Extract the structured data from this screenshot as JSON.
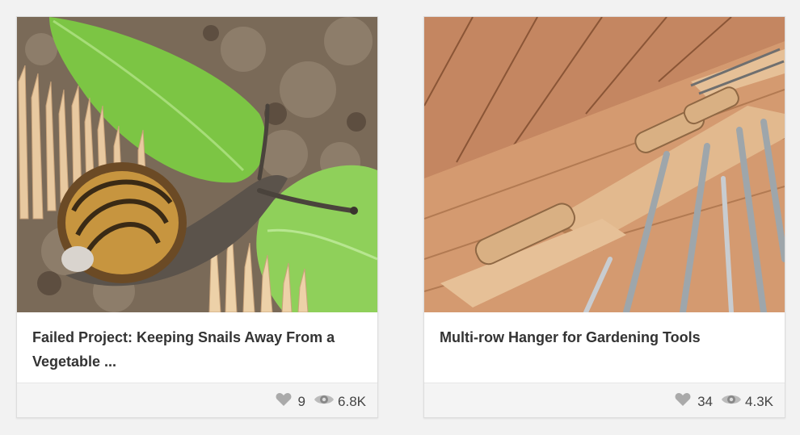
{
  "cards": [
    {
      "title": "Failed Project: Keeping Snails Away From a Vegetable ...",
      "likes": "9",
      "views": "6.8K",
      "image": "snail-on-leaf-with-toothpicks"
    },
    {
      "title": "Multi-row Hanger for Gardening Tools",
      "likes": "34",
      "views": "4.3K",
      "image": "wooden-tool-hanger"
    }
  ],
  "icons": {
    "like": "heart-icon",
    "views": "eye-icon"
  },
  "colors": {
    "title_text": "#333333",
    "stat_text": "#444444",
    "icon_gray": "#aaaaaa",
    "footer_bg": "#f4f4f4"
  }
}
